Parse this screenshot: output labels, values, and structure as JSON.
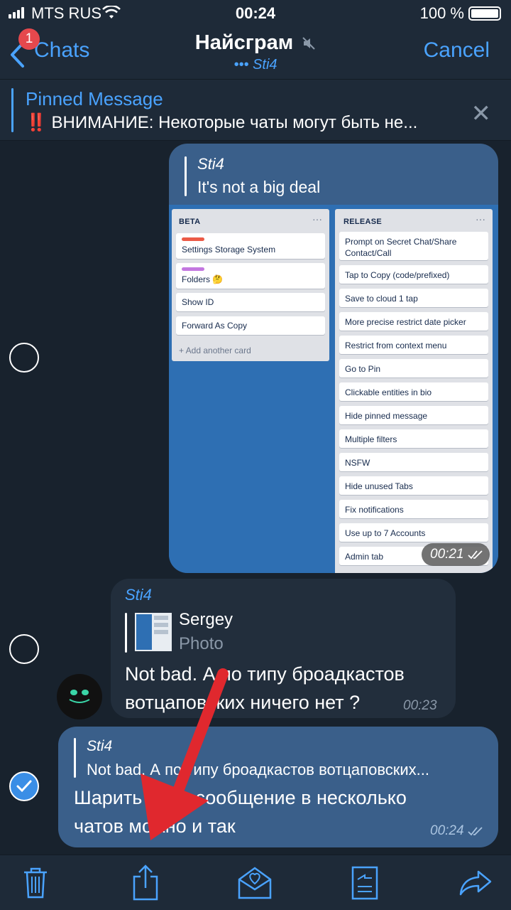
{
  "status": {
    "carrier": "MTS RUS",
    "time": "00:24",
    "battery": "100 %"
  },
  "nav": {
    "back_label": "Chats",
    "back_badge": "1",
    "title": "Найсграм",
    "subtitle": "••• Sti4",
    "cancel_label": "Cancel"
  },
  "pinned": {
    "title": "Pinned Message",
    "text": "‼️ ВНИМАНИЕ: Некоторые чаты могут быть не..."
  },
  "messages": [
    {
      "reply_author": "Sti4",
      "reply_text": "It's not a big deal",
      "time": "00:21",
      "board": {
        "beta": {
          "title": "BETA",
          "cards": [
            "Settings Storage System",
            "Folders 🤔",
            "Show ID",
            "Forward As Copy"
          ],
          "add": "+ Add another card"
        },
        "release": {
          "title": "RELEASE",
          "cards": [
            "Prompt on Secret Chat/Share Contact/Call",
            "Tap to Copy (code/prefixed)",
            "Save to cloud 1 tap",
            "More precise restrict date picker",
            "Restrict from context menu",
            "Go to Pin",
            "Clickable entities in bio",
            "Hide pinned message",
            "Multiple filters",
            "NSFW",
            "Hide unused Tabs",
            "Fix notifications",
            "Use up to 7 Accounts",
            "Admin tab"
          ]
        },
        "menu": "···"
      }
    },
    {
      "author": "Sti4",
      "reply_author": "Sergey",
      "reply_text": "Photo",
      "text": "Not bad. А по типу броадкастов вотцаповских ничего нет ?",
      "time": "00:23"
    },
    {
      "reply_author": "Sti4",
      "reply_text": "Not bad. А по типу броадкастов вотцаповских...",
      "text": "Шарить одно сообщение в несколько чатов можно и так",
      "time": "00:24"
    }
  ],
  "icons": {
    "delete": "trash-icon",
    "share": "share-icon",
    "forward": "forward-icon"
  },
  "colors": {
    "accent": "#4aa3ff",
    "arrow": "#e0282e",
    "outgoing": "#3a5f8a",
    "incoming": "#222e3c"
  }
}
